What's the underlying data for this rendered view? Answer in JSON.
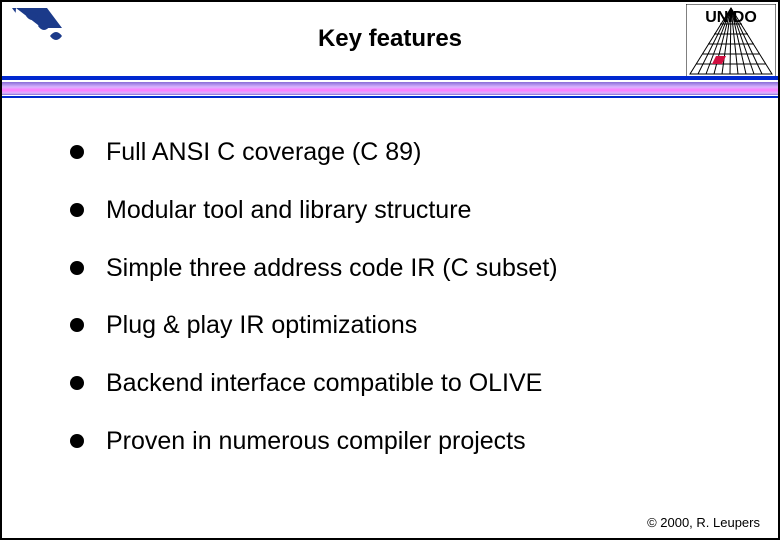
{
  "header": {
    "title": "Key features",
    "logo_right_text": "UNIDO"
  },
  "bullets": [
    "Full ANSI C coverage (C 89)",
    "Modular tool and library structure",
    "Simple three address code IR (C subset)",
    "Plug & play IR optimizations",
    "Backend interface compatible to OLIVE",
    "Proven in numerous compiler projects"
  ],
  "footer": "© 2000, R. Leupers"
}
